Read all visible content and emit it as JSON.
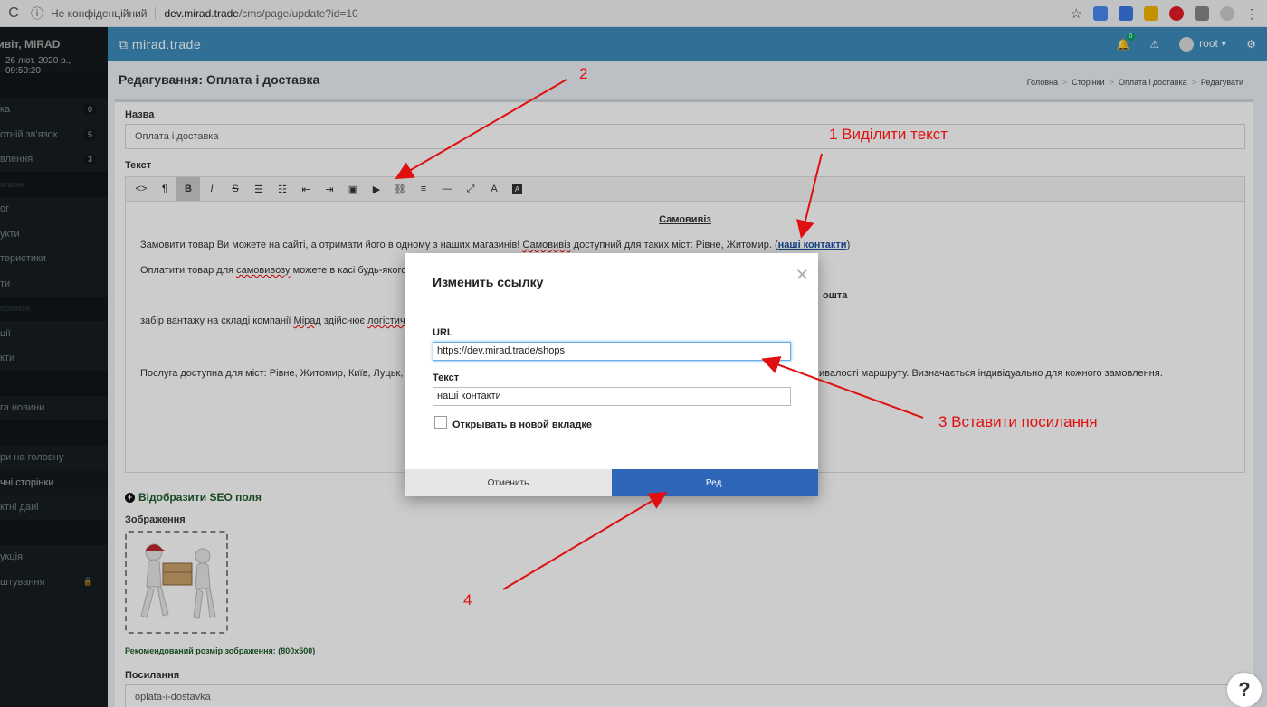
{
  "browser": {
    "not_secure": "Не конфіденційний",
    "url_host": "dev.mirad.trade",
    "url_path": "/cms/page/update?id=10"
  },
  "sidebar": {
    "user": "ривіт, MIRAD",
    "time": "26 лют. 2020 р., 09:50:20",
    "items": [
      {
        "label": "ка",
        "badge": "0"
      },
      {
        "label": "отній зв'язок",
        "badge": "5"
      },
      {
        "label": "влення",
        "badge": "3"
      },
      {
        "header": "агазин"
      },
      {
        "label": "ог"
      },
      {
        "label": "укти"
      },
      {
        "label": "теристики"
      },
      {
        "label": "ти"
      },
      {
        "header": "проекти"
      },
      {
        "label": "ції"
      },
      {
        "label": "кти"
      },
      {
        "label": "га новини"
      },
      {
        "label": "ри на головну"
      },
      {
        "label": "чні сторінки",
        "active": true
      },
      {
        "label": "ктні дані"
      },
      {
        "label": "укція"
      },
      {
        "label": "штування",
        "lock": true
      }
    ]
  },
  "navbar": {
    "brand": "mirad.trade",
    "bell_count": "0",
    "user": "root"
  },
  "page": {
    "title": "Редагування: Оплата і доставка",
    "breadcrumb": [
      "Головна",
      "Сторінки",
      "Оплата і доставка",
      "Редагувати"
    ]
  },
  "form": {
    "name_label": "Назва",
    "name_value": "Оплата і доставка",
    "text_label": "Текст",
    "toolbar": [
      {
        "glyph": "<>",
        "name": "code-view-button"
      },
      {
        "glyph": "¶",
        "name": "paragraph-button"
      },
      {
        "glyph": "B",
        "name": "bold-button",
        "active": true
      },
      {
        "glyph": "I",
        "name": "italic-button"
      },
      {
        "glyph": "S",
        "name": "strikethrough-button"
      },
      {
        "glyph": "☰",
        "name": "unordered-list-button"
      },
      {
        "glyph": "☷",
        "name": "ordered-list-button"
      },
      {
        "glyph": "⇤",
        "name": "outdent-button"
      },
      {
        "glyph": "⇥",
        "name": "indent-button"
      },
      {
        "glyph": "▣",
        "name": "image-button"
      },
      {
        "glyph": "▶",
        "name": "video-button"
      },
      {
        "glyph": "⛓",
        "name": "link-button"
      },
      {
        "glyph": "≡",
        "name": "align-button"
      },
      {
        "glyph": "—",
        "name": "horizontal-rule-button"
      },
      {
        "glyph": "⤢",
        "name": "fullscreen-button"
      },
      {
        "glyph": "A",
        "name": "font-color-button"
      },
      {
        "glyph": "A",
        "name": "background-color-button"
      }
    ],
    "editor": {
      "heading": "Самовивіз",
      "p1_start": "Замовити товар Ви можете на сайті, а отримати його в одному з наших магазинів! ",
      "p1_underlined": "Самовивіз",
      "p1_mid": " доступний для таких міст: Рівне, Житомир. (",
      "p1_link": "наші контакти",
      "p1_end": ")",
      "p2_start": "Оплатити товар для ",
      "p2_underlined": "самовивозу",
      "p2_end": " можете в касі будь-якого м",
      "heading2_fragment": "ошта",
      "p3_start": "забір вантажу на складі компанії ",
      "p3_underlined1": "Мірад",
      "p3_mid": " здійснює ",
      "p3_underlined2": "логістична",
      "p4_start": "Послуга доступна для міст: Рівне, Житомир, Київ, Луцьк, Х",
      "p4_end": "ивалості маршруту. Визначається індивідуально для кожного замовлення."
    },
    "seo_toggle": "Відобразити SEO поля",
    "image_label": "Зображення",
    "image_recommend": "Рекомендований розмір зображення: (800x500)",
    "slug_label": "Посилання",
    "slug_value": "oplata-i-dostavka"
  },
  "modal": {
    "title": "Изменить ссылку",
    "url_label": "URL",
    "url_value": "https://dev.mirad.trade/shops",
    "text_label": "Текст",
    "text_value": "наші контакти",
    "new_tab_label": "Открывать в новой вкладке",
    "cancel": "Отменить",
    "ok": "Ред."
  },
  "annotations": {
    "a1": "1 Виділити текст",
    "a2": "2",
    "a3": "3 Вставити посилання",
    "a4": "4"
  },
  "colors": {
    "navbar": "#3c8dbc",
    "sidebar": "#222d32",
    "primary_button": "#2f66b7",
    "annotation": "#e01010"
  }
}
